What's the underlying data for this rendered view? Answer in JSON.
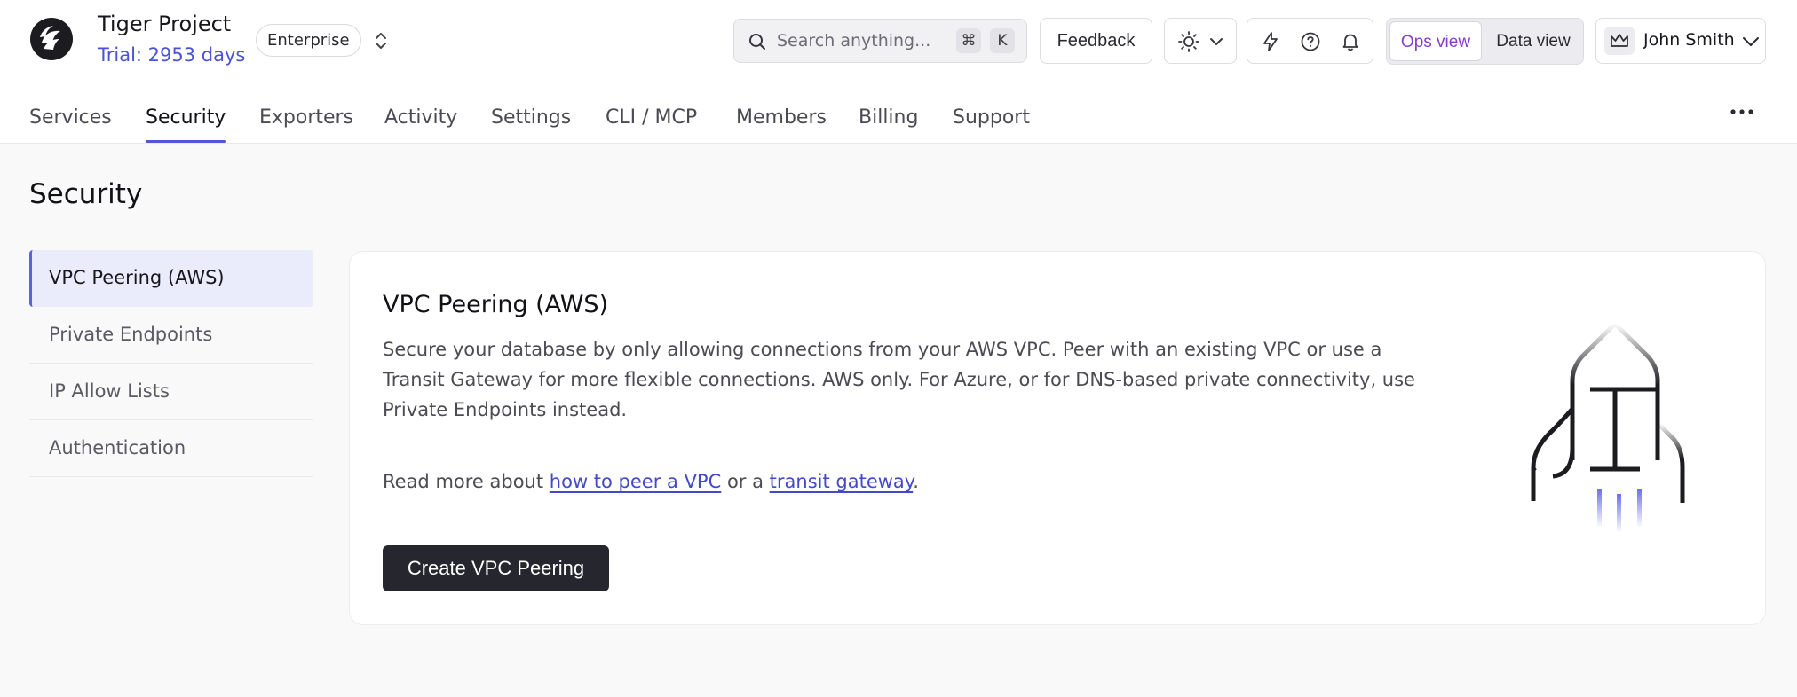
{
  "header": {
    "project_name": "Tiger Project",
    "trial": "Trial: 2953 days",
    "plan": "Enterprise",
    "search": {
      "placeholder": "Search anything...",
      "shortcut_modifier": "⌘",
      "shortcut_key": "K"
    },
    "feedback_label": "Feedback",
    "view_toggle": {
      "ops": "Ops view",
      "data": "Data view",
      "selected": "ops"
    },
    "user_name": "John Smith"
  },
  "tabs": [
    {
      "label": "Services"
    },
    {
      "label": "Security",
      "active": true
    },
    {
      "label": "Exporters"
    },
    {
      "label": "Activity"
    },
    {
      "label": "Settings"
    },
    {
      "label": "CLI / MCP"
    },
    {
      "label": "Members"
    },
    {
      "label": "Billing"
    },
    {
      "label": "Support"
    }
  ],
  "page": {
    "title": "Security",
    "sidenav": [
      {
        "label": "VPC Peering (AWS)",
        "active": true
      },
      {
        "label": "Private Endpoints"
      },
      {
        "label": "IP Allow Lists"
      },
      {
        "label": "Authentication"
      }
    ],
    "card": {
      "title": "VPC Peering (AWS)",
      "description": "Secure your database by only allowing connections from your AWS VPC. Peer with an existing VPC or use a Transit Gateway for more flexible connections. AWS only. For Azure, or for DNS-based private connectivity, use Private Endpoints instead.",
      "read_more_prefix": "Read more about ",
      "link1": "how to peer a VPC",
      "read_more_mid": " or a ",
      "link2": "transit gateway",
      "read_more_suffix": ".",
      "cta": "Create VPC Peering"
    }
  },
  "colors": {
    "accent": "#4f56d8",
    "ops_view": "#8a3bd0",
    "primary_button": "#26262e",
    "active_nav_bg": "#ebecfb"
  }
}
